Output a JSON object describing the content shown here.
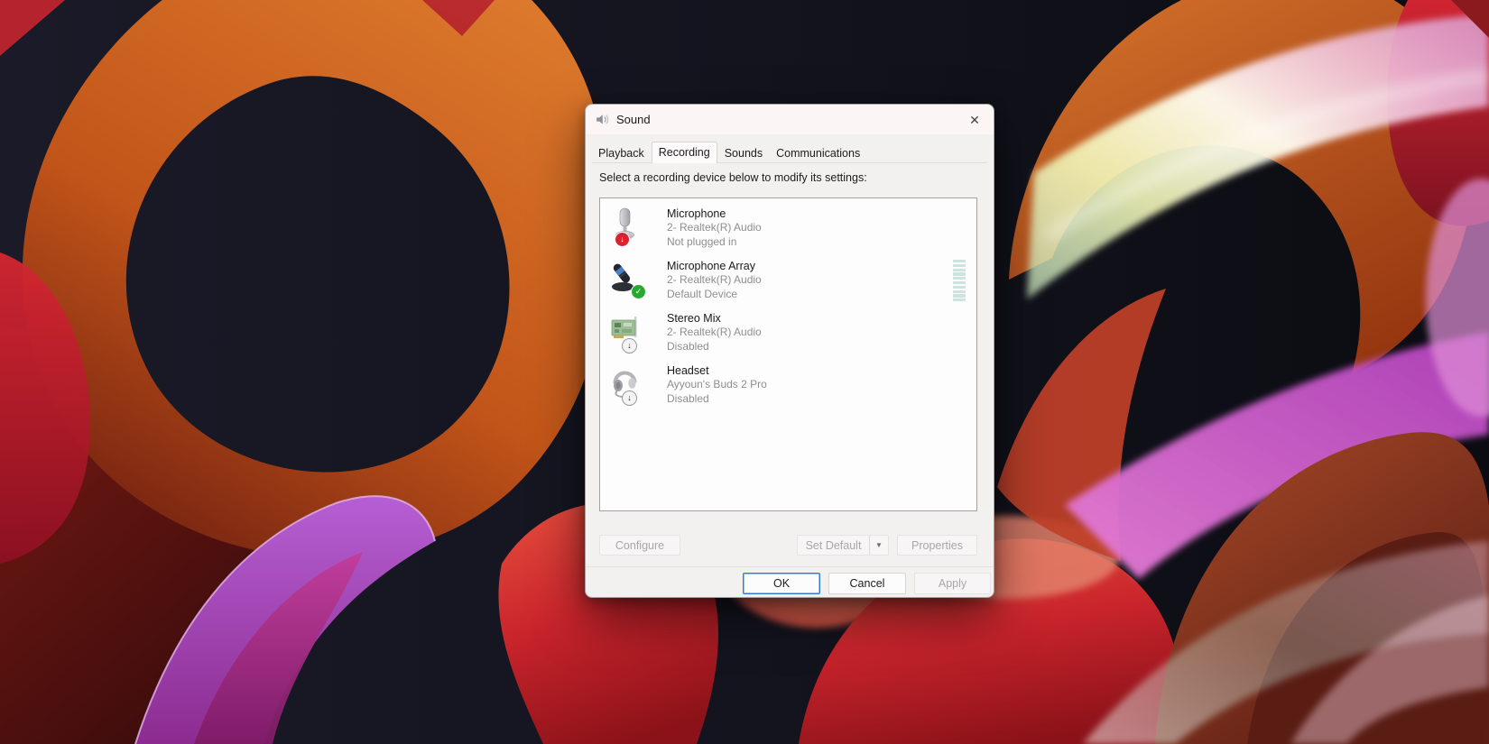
{
  "window": {
    "title": "Sound",
    "close_glyph": "✕"
  },
  "tabs": [
    {
      "label": "Playback",
      "selected": false
    },
    {
      "label": "Recording",
      "selected": true
    },
    {
      "label": "Sounds",
      "selected": false
    },
    {
      "label": "Communications",
      "selected": false
    }
  ],
  "instruction": "Select a recording device below to modify its settings:",
  "devices": [
    {
      "name": "Microphone",
      "description": "2- Realtek(R) Audio",
      "status": "Not plugged in",
      "icon": "desktop-microphone",
      "badge": "red-arrow"
    },
    {
      "name": "Microphone Array",
      "description": "2- Realtek(R) Audio",
      "status": "Default Device",
      "icon": "microphone-array",
      "badge": "green-check",
      "meter_segments": 10
    },
    {
      "name": "Stereo Mix",
      "description": "2- Realtek(R) Audio",
      "status": "Disabled",
      "icon": "sound-card",
      "badge": "white-arrow"
    },
    {
      "name": "Headset",
      "description": "Ayyoun's Buds 2 Pro",
      "status": "Disabled",
      "icon": "headset",
      "badge": "white-arrow"
    }
  ],
  "buttons": {
    "configure": "Configure",
    "set_default": "Set Default",
    "set_default_arrow": "▼",
    "properties": "Properties",
    "ok": "OK",
    "cancel": "Cancel",
    "apply": "Apply"
  },
  "colors": {
    "accent_focus": "#2e7cd6",
    "meter_teal": "#cde3e0",
    "badge_red": "#d9232e",
    "badge_green": "#27a832"
  }
}
